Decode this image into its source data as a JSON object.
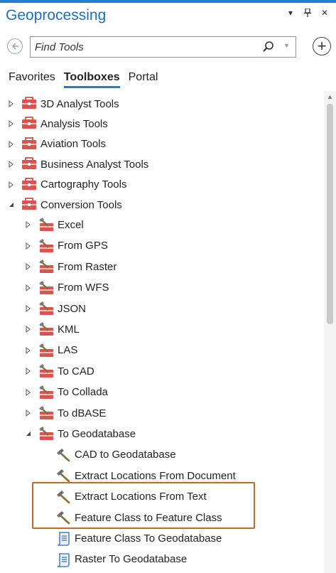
{
  "pane": {
    "title": "Geoprocessing",
    "controls": {
      "menu": "▾",
      "pin": "📌",
      "close": "✕"
    }
  },
  "search": {
    "placeholder": "Find Tools",
    "value": ""
  },
  "tabs": [
    {
      "label": "Favorites",
      "active": false
    },
    {
      "label": "Toolboxes",
      "active": true
    },
    {
      "label": "Portal",
      "active": false
    }
  ],
  "tree": [
    {
      "label": "3D Analyst Tools",
      "type": "toolbox",
      "level": 0,
      "expanded": false
    },
    {
      "label": "Analysis Tools",
      "type": "toolbox",
      "level": 0,
      "expanded": false
    },
    {
      "label": "Aviation Tools",
      "type": "toolbox",
      "level": 0,
      "expanded": false
    },
    {
      "label": "Business Analyst Tools",
      "type": "toolbox",
      "level": 0,
      "expanded": false
    },
    {
      "label": "Cartography Tools",
      "type": "toolbox",
      "level": 0,
      "expanded": false
    },
    {
      "label": "Conversion Tools",
      "type": "toolbox",
      "level": 0,
      "expanded": true
    },
    {
      "label": "Excel",
      "type": "toolset",
      "level": 1,
      "expanded": false
    },
    {
      "label": "From GPS",
      "type": "toolset",
      "level": 1,
      "expanded": false
    },
    {
      "label": "From Raster",
      "type": "toolset",
      "level": 1,
      "expanded": false
    },
    {
      "label": "From WFS",
      "type": "toolset",
      "level": 1,
      "expanded": false
    },
    {
      "label": "JSON",
      "type": "toolset",
      "level": 1,
      "expanded": false
    },
    {
      "label": "KML",
      "type": "toolset",
      "level": 1,
      "expanded": false
    },
    {
      "label": "LAS",
      "type": "toolset",
      "level": 1,
      "expanded": false
    },
    {
      "label": "To CAD",
      "type": "toolset",
      "level": 1,
      "expanded": false
    },
    {
      "label": "To Collada",
      "type": "toolset",
      "level": 1,
      "expanded": false
    },
    {
      "label": "To dBASE",
      "type": "toolset",
      "level": 1,
      "expanded": false
    },
    {
      "label": "To Geodatabase",
      "type": "toolset",
      "level": 1,
      "expanded": true
    },
    {
      "label": "CAD to Geodatabase",
      "type": "tool",
      "level": 2
    },
    {
      "label": "Extract Locations From Document",
      "type": "tool",
      "level": 2
    },
    {
      "label": "Extract Locations From Text",
      "type": "tool",
      "level": 2
    },
    {
      "label": "Feature Class to Feature Class",
      "type": "tool",
      "level": 2
    },
    {
      "label": "Feature Class To Geodatabase",
      "type": "script",
      "level": 2
    },
    {
      "label": "Raster To Geodatabase",
      "type": "script",
      "level": 2
    }
  ],
  "colors": {
    "accent": "#1f7ed1",
    "title": "#1c6fc6",
    "toolbox": "#d9534f",
    "highlight": "#c26a2b"
  }
}
